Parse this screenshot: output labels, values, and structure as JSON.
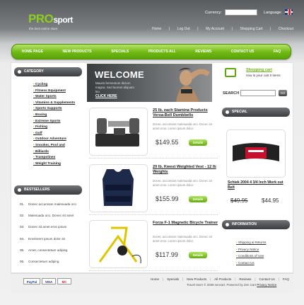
{
  "header": {
    "logo_pro": "PRO",
    "logo_sport": "sport",
    "tagline": "the best online store",
    "currency_label": "Currency:",
    "language_label": "Language:",
    "top_links": [
      "Home",
      "Log Out",
      "My Account",
      "Shopping Cart",
      "Checkout"
    ]
  },
  "nav": [
    "HOME PAGE",
    "NEW PRODUCTS",
    "SPECIALS",
    "PRODUCTS ALL",
    "REVIEWS",
    "CONTACT US",
    "FAQ"
  ],
  "sidebar": {
    "category_title": "CATEGORY",
    "categories": [
      "Cycling",
      "Fitness Equipment",
      "Water Sports",
      "Vitamins & Supplements",
      "Sports Supports",
      "Boxing",
      "Extreme Sports",
      "Fishing",
      "Golf",
      "Outdoor Adventure",
      "Snooker, Pool and",
      "Billiards",
      "Trampolines",
      "Weight Training"
    ],
    "bestsellers_title": "BESTSELLERS",
    "bestsellers": [
      {
        "num": "01.",
        "text": "Donec accumsan malesuada orci"
      },
      {
        "num": "02.",
        "text": "Malesuada orci. Donec sit amet"
      },
      {
        "num": "03.",
        "text": "Donec sit amet eros ipsum"
      },
      {
        "num": "04.",
        "text": "Eroslorem ipsum dolor sit"
      },
      {
        "num": "05.",
        "text": "Amet, consectetuer adipisg"
      },
      {
        "num": "06.",
        "text": "Consectetuer adiping"
      }
    ]
  },
  "welcome": {
    "title": "WELCOME",
    "text": "Mauris fermentum dictum magna. Sed laoreet aliquam leo.",
    "link": "CLICK HERE"
  },
  "products": [
    {
      "name": "25 lb. each Stamina Products Versa-Bell Dumbbells",
      "desc": "Donec accumsan malesuada orci. Donec sit amet eros. Lorem ipsum dolor.",
      "price": "$149.55",
      "button": "Details"
    },
    {
      "name": "20 lb. Kwest Weighted Vest - 12 lb Weights",
      "desc": "Donec accumsan malesuada orci. Donec sit amet eros. Lorem ipsum dolor.",
      "price": "$155.99",
      "button": "Details"
    },
    {
      "name": "Forza F-1 Magnetic Bicycle Trainer",
      "desc": "Donec accumsan malesuada orci. Donec sit amet eros. Lorem ipsum dolor.",
      "price": "$117.99",
      "button": "Details"
    }
  ],
  "cart": {
    "title": "Shopping cart",
    "text": "now in your cart 0 items"
  },
  "search": {
    "label": "SEARCH",
    "button": "GO"
  },
  "special": {
    "title": "SPECIAL",
    "name": "Schiek 2004 4 3/4 Inch Work out Belt",
    "old_price": "$49.95",
    "new_price": "$44.95"
  },
  "information": {
    "title": "INFORMATION",
    "links": [
      "Shipping & Returns",
      "Privacy Notice",
      "Conditions of Use",
      "Contact Us"
    ]
  },
  "footer": {
    "links": [
      "Home",
      "Specials",
      "New Products",
      "All Products",
      "Reviews",
      "Contact Us",
      "FAQ"
    ],
    "copyright": "Travel store © 2009 sencart. Powered by Zen Cart ",
    "privacy": "Privacy Notice",
    "pay_logos": [
      "PayPal",
      "VISA",
      "MC"
    ]
  },
  "colors": {
    "accent": "#6fb811",
    "dark": "#3b3e40"
  }
}
